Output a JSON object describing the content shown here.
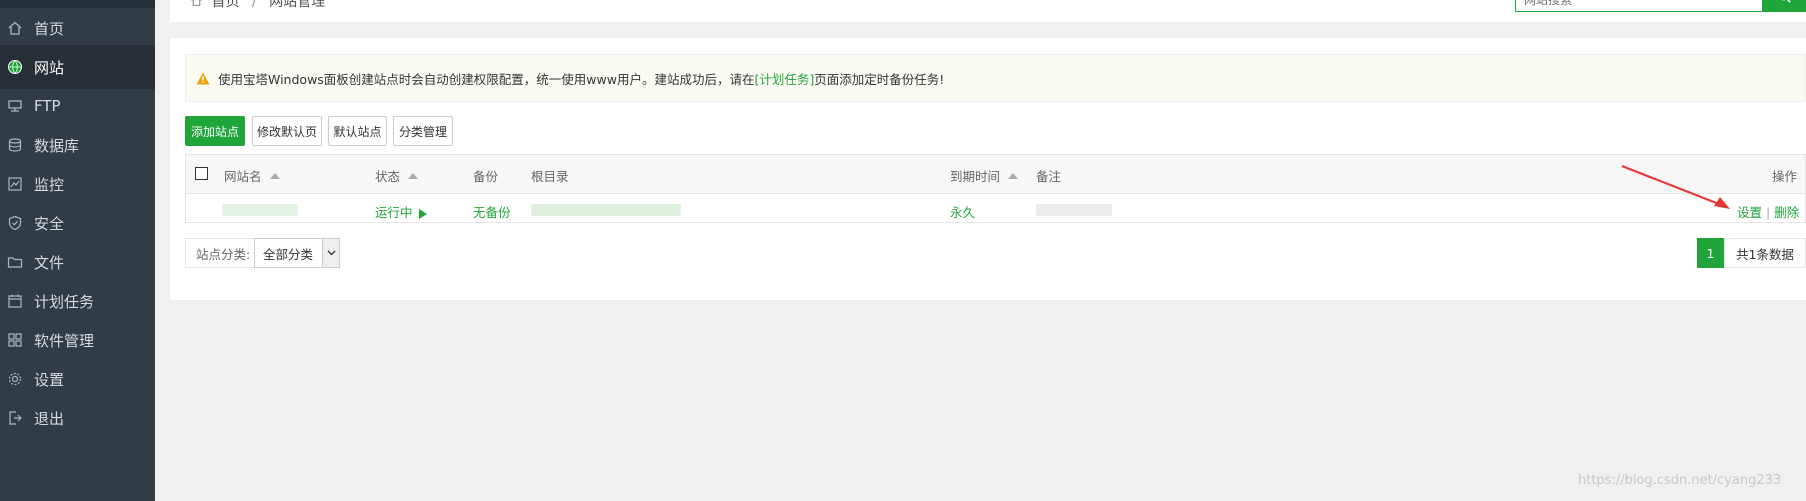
{
  "sidebar": {
    "items": [
      {
        "label": "首页",
        "icon": "home-icon"
      },
      {
        "label": "网站",
        "icon": "globe-icon",
        "active": true
      },
      {
        "label": "FTP",
        "icon": "ftp-icon"
      },
      {
        "label": "数据库",
        "icon": "database-icon"
      },
      {
        "label": "监控",
        "icon": "monitor-icon"
      },
      {
        "label": "安全",
        "icon": "shield-icon"
      },
      {
        "label": "文件",
        "icon": "folder-icon"
      },
      {
        "label": "计划任务",
        "icon": "calendar-icon"
      },
      {
        "label": "软件管理",
        "icon": "apps-icon"
      },
      {
        "label": "设置",
        "icon": "gear-icon"
      },
      {
        "label": "退出",
        "icon": "logout-icon"
      }
    ]
  },
  "header": {
    "breadcrumb": [
      "首页",
      "网站管理"
    ],
    "search_placeholder": "网站搜索"
  },
  "notice": {
    "text_before": "使用宝塔Windows面板创建站点时会自动创建权限配置，统一使用www用户。建站成功后，请在",
    "link": "[计划任务]",
    "text_after": "页面添加定时备份任务!"
  },
  "toolbar": {
    "add_site": "添加站点",
    "edit_default_page": "修改默认页",
    "default_site": "默认站点",
    "category_manage": "分类管理"
  },
  "table": {
    "headers": {
      "name": "网站名",
      "status": "状态",
      "backup": "备份",
      "root": "根目录",
      "expire": "到期时间",
      "remark": "备注",
      "actions": "操作"
    },
    "rows": [
      {
        "status": "运行中",
        "backup": "无备份",
        "expire": "永久",
        "action_settings": "设置",
        "action_separator": "|",
        "action_delete": "删除"
      }
    ]
  },
  "footer": {
    "category_label": "站点分类:",
    "category_value": "全部分类",
    "page": "1",
    "total": "共1条数据"
  },
  "watermark": "https://blog.csdn.net/cyang233",
  "colors": {
    "accent": "#20a53a",
    "sidebar_bg": "#323c44",
    "sidebar_active": "#272e36",
    "annotation_arrow": "#e53935"
  }
}
